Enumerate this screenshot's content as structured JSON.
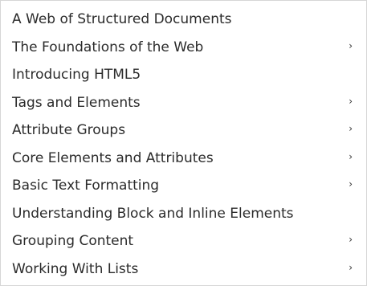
{
  "menu": {
    "items": [
      {
        "label": "A Web of Structured Documents",
        "has_submenu": false
      },
      {
        "label": "The Foundations of the Web",
        "has_submenu": true
      },
      {
        "label": "Introducing HTML5",
        "has_submenu": false
      },
      {
        "label": "Tags and Elements",
        "has_submenu": true
      },
      {
        "label": "Attribute Groups",
        "has_submenu": true
      },
      {
        "label": "Core Elements and Attributes",
        "has_submenu": true
      },
      {
        "label": "Basic Text Formatting",
        "has_submenu": true
      },
      {
        "label": "Understanding Block and Inline Elements",
        "has_submenu": false
      },
      {
        "label": "Grouping Content",
        "has_submenu": true
      },
      {
        "label": "Working With Lists",
        "has_submenu": true
      }
    ],
    "submenu_glyph": "›",
    "submenu_icon": "chevron-right-icon",
    "text_color": "#2b2b2b",
    "border_color": "#d6d6d6",
    "background_color": "#ffffff"
  }
}
